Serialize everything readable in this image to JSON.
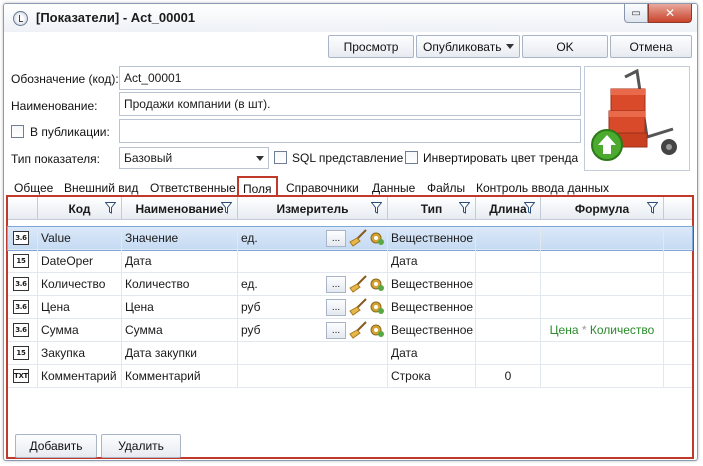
{
  "window": {
    "title": "[Показатели] - Act_00001",
    "close_glyph": "✕",
    "min_glyph": "▭"
  },
  "toolbar": {
    "view": "Просмотр",
    "publish": "Опубликовать",
    "ok": "OK",
    "cancel": "Отмена"
  },
  "form": {
    "code_label": "Обозначение (код):",
    "code_value": "Act_00001",
    "name_label": "Наименование:",
    "name_value": "Продажи компании (в шт).",
    "publication_label": "В публикации:",
    "publication_value": "",
    "type_label": "Тип показателя:",
    "type_value": "Базовый",
    "sql_label": "SQL представление",
    "invert_label": "Инвертировать цвет тренда"
  },
  "tabs": [
    "Общее",
    "Внешний вид",
    "Ответственные",
    "Поля",
    "Справочники",
    "Данные",
    "Файлы",
    "Контроль ввода данных"
  ],
  "active_tab": "Поля",
  "grid": {
    "columns": [
      "Код",
      "Наименование",
      "Измеритель",
      "Тип",
      "Длина",
      "Формула"
    ],
    "ellipsis": "...",
    "rows": [
      {
        "icon": "3.6",
        "code": "Value",
        "name": "Значение",
        "unit": "ед.",
        "type": "Вещественное",
        "length": "",
        "formula": ""
      },
      {
        "icon": "15",
        "code": "DateOper",
        "name": "Дата",
        "unit": "",
        "type": "Дата",
        "length": "",
        "formula": ""
      },
      {
        "icon": "3.6",
        "code": "Количество",
        "name": "Количество",
        "unit": "ед.",
        "type": "Вещественное",
        "length": "",
        "formula": ""
      },
      {
        "icon": "3.6",
        "code": "Цена",
        "name": "Цена",
        "unit": "руб",
        "type": "Вещественное",
        "length": "",
        "formula": ""
      },
      {
        "icon": "3.6",
        "code": "Сумма",
        "name": "Сумма",
        "unit": "руб",
        "type": "Вещественное",
        "length": "",
        "formula": "Цена * Количество",
        "formula_a": "Цена",
        "formula_op": "*",
        "formula_b": "Количество"
      },
      {
        "icon": "15",
        "code": "Закупка",
        "name": "Дата закупки",
        "unit": "",
        "type": "Дата",
        "length": "",
        "formula": ""
      },
      {
        "icon": "TXT",
        "code": "Комментарий",
        "name": "Комментарий",
        "unit": "",
        "type": "Строка",
        "length": "0",
        "formula": ""
      }
    ]
  },
  "buttons": {
    "add": "Добавить",
    "delete": "Удалить"
  },
  "colors": {
    "highlight_red": "#c0392b",
    "formula_green": "#2a8a2a",
    "selection": "#c6dbf3"
  }
}
